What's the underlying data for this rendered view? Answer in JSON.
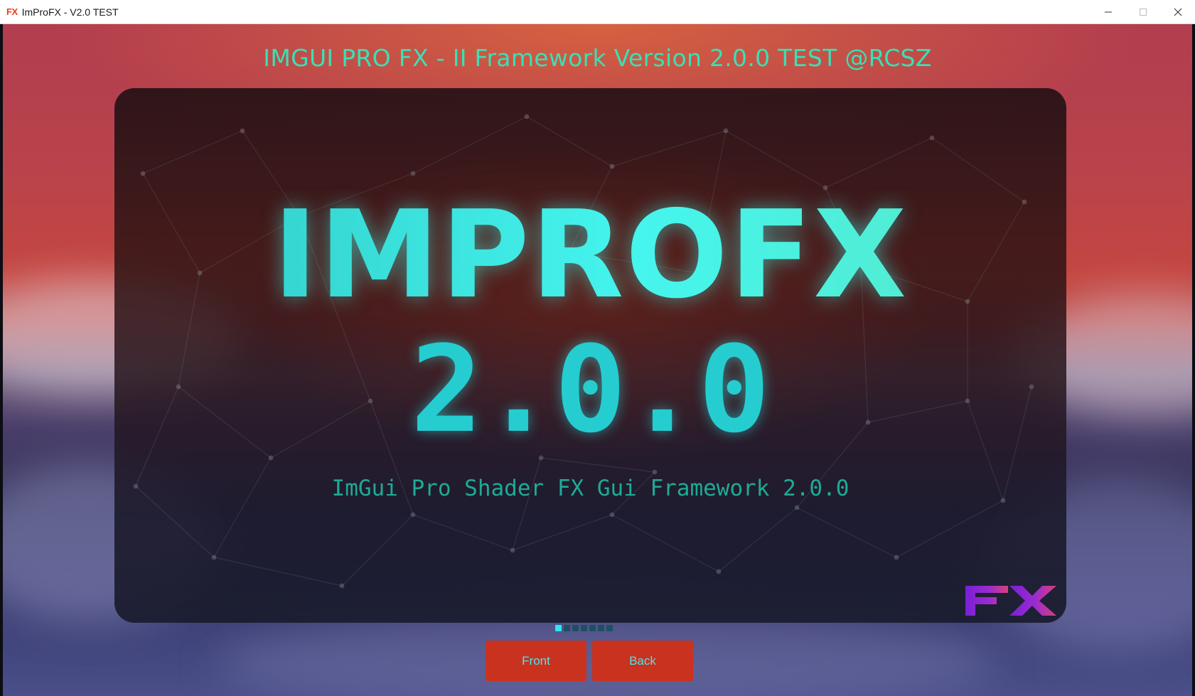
{
  "window": {
    "icon_text": "FX",
    "title": "ImProFX - V2.0 TEST"
  },
  "header": {
    "title": "IMGUI PRO FX - II Framework Version 2.0.0 TEST @RCSZ"
  },
  "card": {
    "title": "IMPROFX",
    "version": "2.0.0",
    "subtitle": "ImGui Pro Shader FX Gui Framework 2.0.0",
    "logo_text": "FX"
  },
  "pager": {
    "total": 7,
    "active_index": 0
  },
  "buttons": {
    "front_label": "Front",
    "back_label": "Back"
  },
  "colors": {
    "accent_text": "#39e0b5",
    "button_bg": "#c9321f",
    "button_text": "#47e8f0",
    "logo_purple": "#8a2be2",
    "logo_pink": "#d43a7a"
  }
}
